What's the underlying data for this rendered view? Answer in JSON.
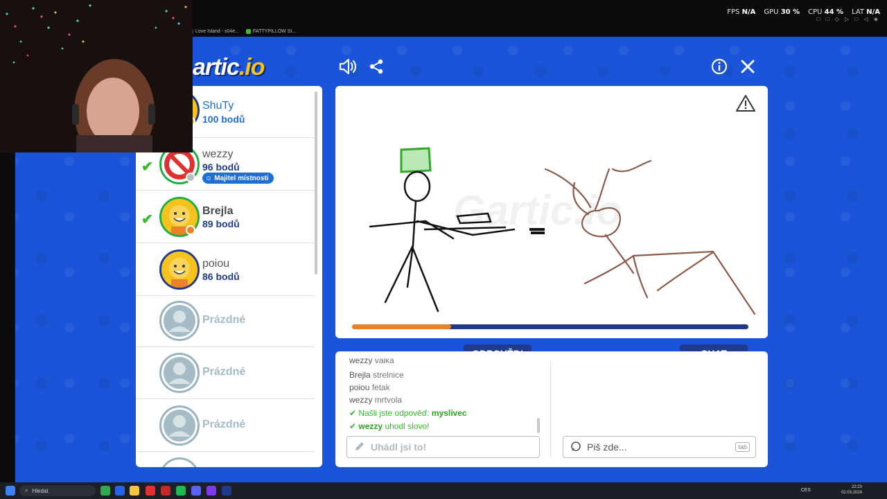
{
  "browser_tabs": [
    {
      "label": "Love Island - s04e..."
    },
    {
      "label": "FATTYPILLOW St..."
    }
  ],
  "perf": [
    {
      "label": "FPS",
      "value": "N/A"
    },
    {
      "label": "GPU",
      "value": "30 %"
    },
    {
      "label": "CPU",
      "value": "44 %"
    },
    {
      "label": "LAT",
      "value": "N/A"
    }
  ],
  "logo": {
    "main": "artic",
    "suffix": ".io"
  },
  "players": [
    {
      "name": "ShuTy",
      "score": "100 bodů",
      "checked": false,
      "state": "player"
    },
    {
      "name": "wezzy",
      "score": "96 bodů",
      "checked": true,
      "state": "banned",
      "badge": "Majitel místnosti"
    },
    {
      "name": "Brejla",
      "score": "89 bodů",
      "checked": true,
      "state": "player"
    },
    {
      "name": "poiou",
      "score": "86 bodů",
      "checked": false,
      "state": "player"
    },
    {
      "name": "",
      "empty_label": "Prázdné",
      "state": "empty"
    },
    {
      "name": "",
      "empty_label": "Prázdné",
      "state": "empty"
    },
    {
      "name": "",
      "empty_label": "Prázdné",
      "state": "empty"
    }
  ],
  "round_progress": 0.25,
  "colors": {
    "brand_blue": "#1f3a8a",
    "background_blue": "#1a55d9",
    "progress": "#e9822a",
    "success": "#33b92b"
  },
  "tabs": {
    "answers": "ODPOVĚDI",
    "chat": "CHAT"
  },
  "answers": [
    {
      "who": "wezzy",
      "text": "valka",
      "type": "guess"
    },
    {
      "who": "Brejla",
      "text": "strelnice",
      "type": "guess"
    },
    {
      "who": "poiou",
      "text": "fetak",
      "type": "guess"
    },
    {
      "who": "wezzy",
      "text": "mrtvola",
      "type": "guess"
    },
    {
      "who": "",
      "text": "Našli jste odpověď:",
      "strong": "myslivec",
      "type": "success"
    },
    {
      "who": "wezzy",
      "text": "uhodl slovo!",
      "type": "success"
    }
  ],
  "answer_input": {
    "placeholder": "Uhádl jsi to!"
  },
  "chat_input": {
    "placeholder": "Piš zde...",
    "key_hint": "tab"
  },
  "taskbar": {
    "search": "Hledat",
    "lang": "CES",
    "time": "22:23",
    "date": "02.03.2024"
  }
}
